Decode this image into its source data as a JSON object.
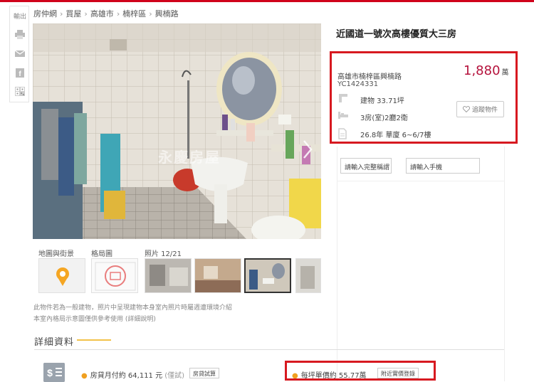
{
  "share": {
    "label": "輸出",
    "icons": [
      "printer-icon",
      "mail-icon",
      "facebook-icon",
      "qrcode-icon"
    ]
  },
  "breadcrumb": {
    "items": [
      "房仲網",
      "買屋",
      "高雄市",
      "楠梓區",
      "興楠路"
    ],
    "separator": "›"
  },
  "photo": {
    "watermark": "永慶房屋"
  },
  "thumbnails": {
    "labels": {
      "map": "地圖與街景",
      "layout": "格局圖",
      "photos": "照片 12/21"
    }
  },
  "notes": {
    "line1": "此物件若為一般建物，照片中呈現建物本身室內照片時屬週遭環境介紹",
    "line2_text": "本室內格局示意圖僅供參考使用",
    "line2_link": "(詳細說明)"
  },
  "listing": {
    "title": "近國道一號次高樓優質大三房",
    "address": "高雄市楠梓區興楠路",
    "code": "YC1424331",
    "price": "1,880",
    "price_unit": "萬",
    "area": "建物 33.71坪",
    "rooms": "3房(室)2廳2衛",
    "age_floor": "26.8年 華廈 6~6/7樓",
    "track_label": "追蹤物件"
  },
  "contact": {
    "name_placeholder": "請輸入完整稱謂",
    "phone_placeholder": "請輸入手機"
  },
  "details": {
    "section_title": "詳細資料",
    "mortgage_label": "房貸月付約",
    "mortgage_value": "64,111 元",
    "mortgage_note": "(僅試)",
    "mortgage_button": "房貸試算",
    "unit_price_label": "每坪單價約",
    "unit_price_value": "55.77萬",
    "nearby_button": "附近實價登錄"
  },
  "colors": {
    "accent": "#d0021b",
    "price": "#b5123c",
    "highlight_box": "#d71920"
  }
}
